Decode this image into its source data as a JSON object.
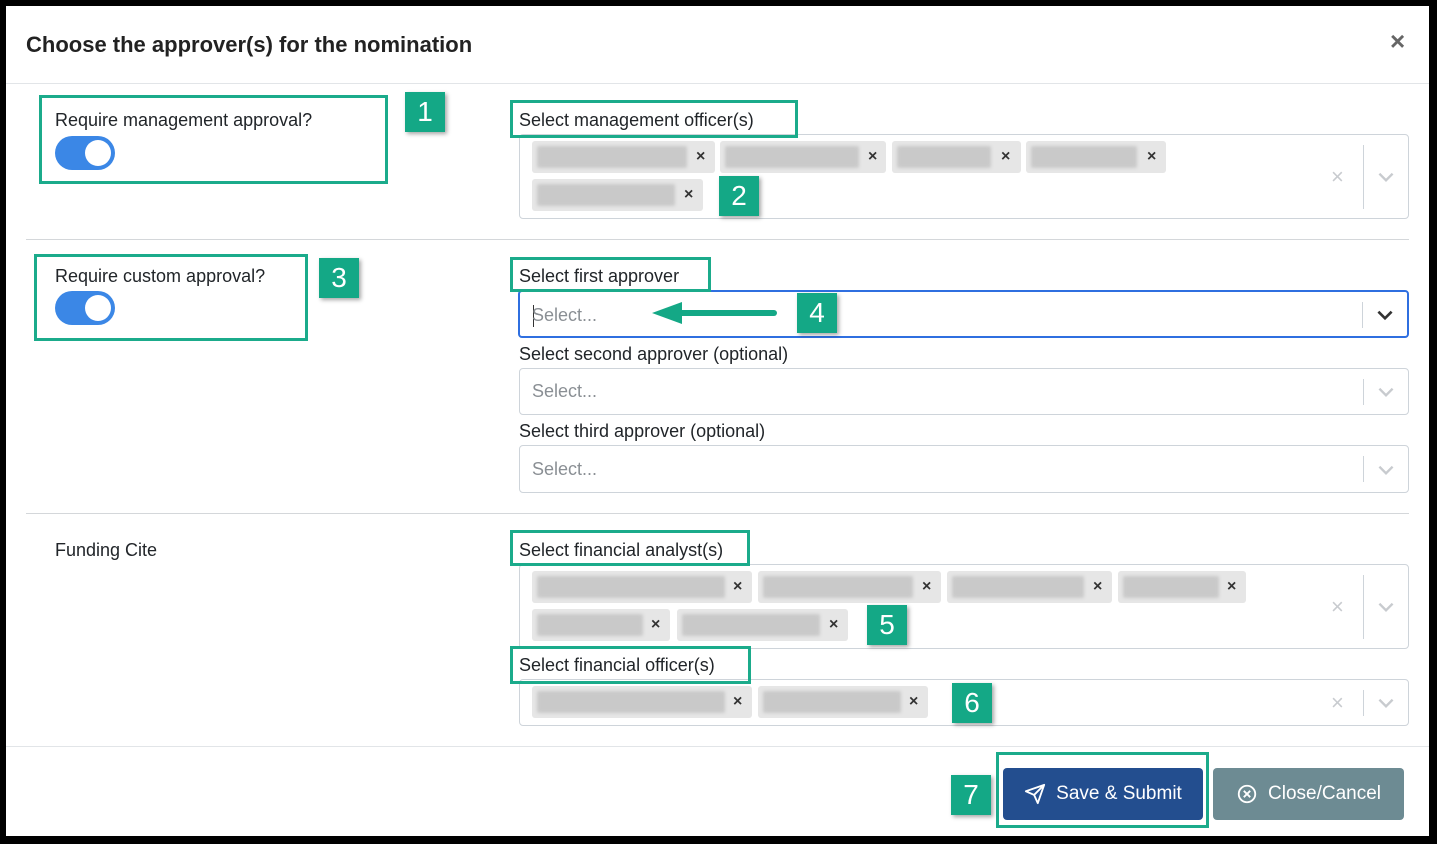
{
  "modal": {
    "title": "Choose the approver(s) for the nomination",
    "close_icon": "×"
  },
  "management": {
    "toggle_label": "Require management approval?",
    "toggle_on": true,
    "select_label": "Select management officer(s)",
    "chip_count": 5
  },
  "custom": {
    "toggle_label": "Require custom approval?",
    "toggle_on": true,
    "first_label": "Select first approver",
    "first_placeholder": "Select...",
    "second_label": "Select second approver (optional)",
    "second_placeholder": "Select...",
    "third_label": "Select third approver (optional)",
    "third_placeholder": "Select..."
  },
  "funding": {
    "section_label": "Funding Cite",
    "analyst_label": "Select financial analyst(s)",
    "analyst_chip_count": 6,
    "officer_label": "Select financial officer(s)",
    "officer_chip_count": 2
  },
  "footer": {
    "submit_label": "Save & Submit",
    "cancel_label": "Close/Cancel"
  },
  "callouts": [
    "1",
    "2",
    "3",
    "4",
    "5",
    "6",
    "7"
  ],
  "chip_remove_icon": "×",
  "clear_icon": "×",
  "colors": {
    "accent": "#1bab8b",
    "toggle": "#3b87e6",
    "primary": "#234e8f",
    "secondary": "#6d8b93",
    "focus": "#2f6fe0"
  }
}
